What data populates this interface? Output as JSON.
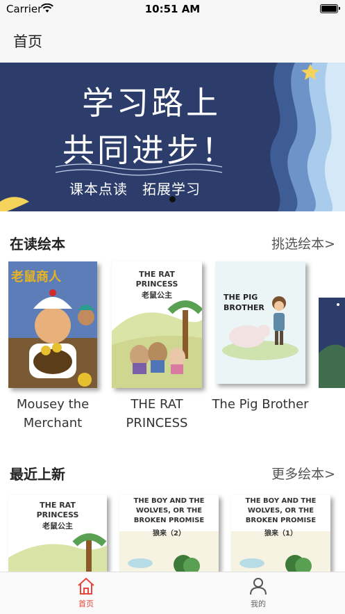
{
  "status": {
    "carrier": "Carrier",
    "time": "10:51 AM"
  },
  "nav": {
    "title": "首页"
  },
  "banner": {
    "line1": "学习路上",
    "line2": "共同进步！",
    "subtitle": "课本点读　拓展学习"
  },
  "reading": {
    "title": "在读绘本",
    "link": "挑选绘本>",
    "books": [
      {
        "title": "Mousey the Merchant",
        "cover_text": "老鼠商人"
      },
      {
        "title": "THE RAT PRINCESS",
        "cover_text": "THE RAT PRINCESS",
        "cover_sub": "老鼠公主"
      },
      {
        "title": "The Pig Brother",
        "cover_text": "THE PIG BROTHER"
      }
    ]
  },
  "recent": {
    "title": "最近上新",
    "link": "更多绘本>",
    "books": [
      {
        "cover_text": "THE RAT PRINCESS",
        "cover_sub": "老鼠公主"
      },
      {
        "cover_text": "THE BOY AND THE WOLVES, OR THE BROKEN PROMISE",
        "cover_sub": "狼来（2）"
      },
      {
        "cover_text": "THE BOY AND THE WOLVES, OR THE BROKEN PROMISE",
        "cover_sub": "狼来（1）"
      }
    ]
  },
  "tabs": [
    {
      "label": "首页",
      "icon": "home-icon",
      "active": true
    },
    {
      "label": "我的",
      "icon": "user-icon",
      "active": false
    }
  ],
  "colors": {
    "accent": "#e8453c",
    "banner_bg": "#2c3d6b",
    "tab_inactive": "#666666"
  }
}
